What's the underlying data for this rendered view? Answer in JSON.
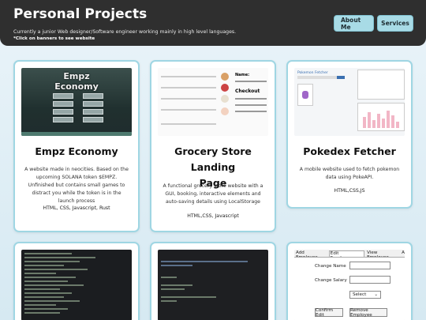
{
  "header": {
    "title": "Personal Projects",
    "subtitle": "Currently a junior Web designer/Software engineer working mainly in high level languages.",
    "hint": "*Click on banners to see website",
    "nav": {
      "about": "About Me",
      "services": "Services"
    }
  },
  "projects": [
    {
      "title": "Empz Economy",
      "description": "A website made in neocities. Based on the upcoming SOLANA token $EMPZ. Unfinished but contains small games to distract you while the token is in the launch process",
      "tech": "HTML, CSS, Javascript, Rust",
      "screenshot_title_line1": "Empz",
      "screenshot_title_line2": "Economy"
    },
    {
      "title_line1": "Grocery Store Landing",
      "title_line2": "Page",
      "description": "A functional grocery store website with a GUI, booking, interactive elements and auto-saving details using LocalStorage",
      "tech": "HTML,CSS, Javascript",
      "screenshot_labels": {
        "name": "Name:",
        "checkout": "Checkout"
      }
    },
    {
      "title": "Pokedex Fetcher",
      "description": "A mobile website used to fetch pokemon data using PokeAPI.",
      "tech": "HTML,CSS,JS",
      "screenshot_header": "Pokemon Fetcher"
    }
  ],
  "winforms": {
    "tabs": [
      "Add Employee",
      "Edit Employees",
      "View Employee",
      "A"
    ],
    "change_name": "Change Name",
    "change_salary": "Change Salary",
    "select": "Select",
    "confirm": "Confirm Edit",
    "remove": "Remove Employee"
  }
}
